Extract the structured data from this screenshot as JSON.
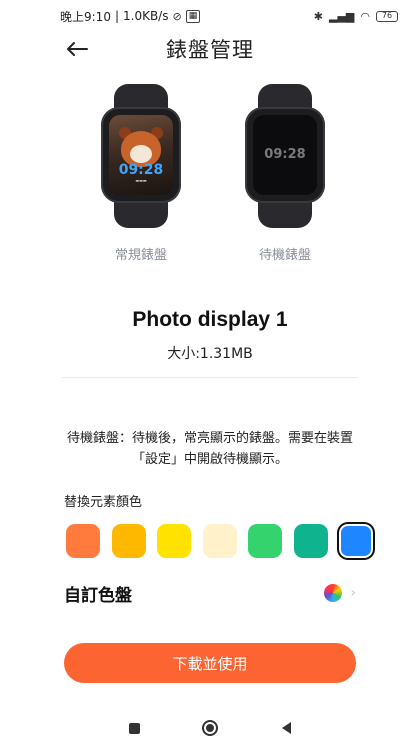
{
  "status_bar": {
    "time_text": "晚上9:10",
    "speed": "1.0KB/s",
    "battery": "76"
  },
  "header": {
    "title": "錶盤管理"
  },
  "watches": {
    "normal": {
      "label": "常規錶盤",
      "time": "09:28"
    },
    "standby": {
      "label": "待機錶盤",
      "time": "09:28"
    }
  },
  "face": {
    "name": "Photo display 1",
    "size": "大小:1.31MB"
  },
  "description": "待機錶盤：待機後，常亮顯示的錶盤。需要在裝置「設定」中開啟待機顯示。",
  "color_section": {
    "title": "替換元素顏色",
    "swatches": [
      "#ff7a3d",
      "#ffb800",
      "#ffe200",
      "#fff1c9",
      "#34d36e",
      "#0fb48e",
      "#1e86ff"
    ],
    "selected_index": 6
  },
  "custom_palette": {
    "label": "自訂色盤"
  },
  "cta": {
    "label": "下載並使用"
  },
  "colors": {
    "accent": "#fc6432",
    "label_gray": "#8a8f9a"
  }
}
